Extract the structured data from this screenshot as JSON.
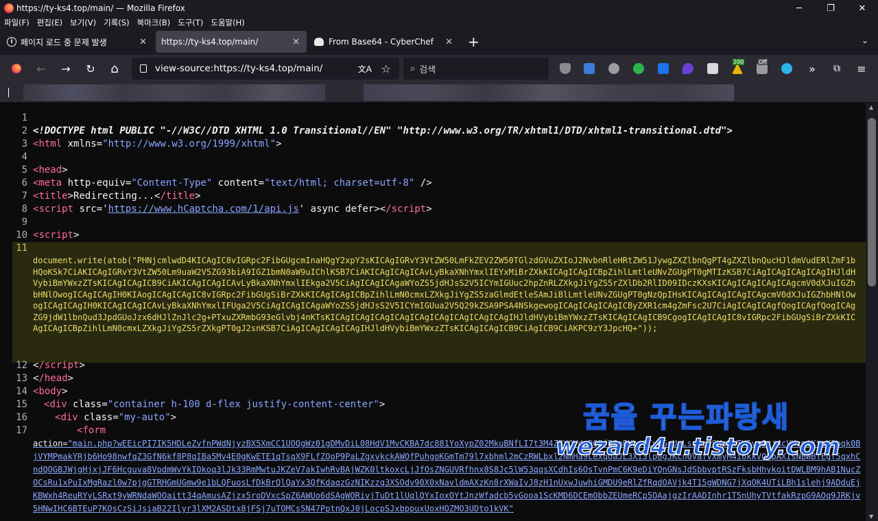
{
  "window": {
    "title": "https://ty-ks4.top/main/ — Mozilla Firefox",
    "minimize": "─",
    "maximize": "❐",
    "close": "✕"
  },
  "menu": [
    "파일(F)",
    "편집(E)",
    "보기(V)",
    "기록(S)",
    "북마크(B)",
    "도구(T)",
    "도움말(H)"
  ],
  "tabs": [
    {
      "label": "페이지 로드 중 문제 발생",
      "close": "✕"
    },
    {
      "label": "https://ty-ks4.top/main/",
      "close": "✕"
    },
    {
      "label": "From Base64 - CyberChef",
      "close": "✕"
    }
  ],
  "tabbar": {
    "new_tab": "+",
    "list_all": "⌄"
  },
  "nav": {
    "url": "view-source:https://ty-ks4.top/main/",
    "search_placeholder": "검색",
    "back": "←",
    "forward": "→",
    "reload": "↻",
    "home": "⌂",
    "badge_count": "200",
    "badge_off": "Off"
  },
  "source": {
    "line_numbers": [
      "1",
      "2",
      "3",
      "4",
      "5",
      "6",
      "7",
      "8",
      "9",
      "10",
      "11",
      "12",
      "13",
      "14",
      "15",
      "16",
      "17"
    ],
    "doctype": "<!DOCTYPE html PUBLIC \"-//W3C//DTD XHTML 1.0 Transitional//EN\" \"http://www.w3.org/TR/xhtml1/DTD/xhtml1-transitional.dtd\">",
    "html_tag": "html",
    "xmlns_attr": "xmlns",
    "xmlns_val": "\"http://www.w3.org/1999/xhtml\"",
    "head_tag": "head",
    "meta_tag": "meta",
    "http_equiv_attr": "http-equiv",
    "http_equiv_val": "\"Content-Type\"",
    "content_attr": "content",
    "content_val": "\"text/html; charset=utf-8\"",
    "meta_close": " />",
    "title_tag": "title",
    "title_text": "Redirecting...",
    "title_close": "/title",
    "script_tag": "script",
    "src_attr": "src",
    "src_q": "'",
    "src_link": "https://www.hCaptcha.com/1/api.js",
    "async_defer": " async defer",
    "script_close": "/script",
    "script_open_10": "script",
    "base64_js": "document.write(atob(\"PHNjcmlwdD4KICAgIC8vIGRpc2FibGUgcmInaHQgY2xpY2sKICAgIGRvY3VtZW50LmFkZEV2ZW50TGlzdGVuZXIoJ2NvbnRleHRtZW51JywgZXZlbnQgPT4gZXZlbnQucHJldmVudERlZmF1bHQoKSk7CiAKICAgIGRvY3VtZW50Lm9uaW2V5ZG93biA9IGZ1bmN0aW9uIChlKSB7CiAKICAgICAgICAvLyBkaXNhYmxlIEYxMiBrZXkKICAgICAgICBpZihlLmtleUNvZGUgPT0gMTIzKSB7CiAgICAgICAgICAgIHJldHVybiBmYWxzZTsKICAgICAgICB9CiAKICAgICAgICAvLyBkaXNhYmxlIEkga2V5CiAgICAgICAgaWYoZS5jdHJsS2V5ICYmIGUuc2hpZnRLZXkgJiYgZS5rZXlDb2RlID09IDczKXsKICAgICAgICAgICAgcmV0dXJuIGZhbHNlOwogICAgICAgIH0KIAogICAgICAgIC8vIGRpc2FibGUgSiBrZXkKICAgICAgICBpZihlLmN0cmxLZXkgJiYgZS5zaGlmdEtleSAmJiBlLmtleUNvZGUgPT0gNzQpIHsKICAgICAgICAgICAgcmV0dXJuIGZhbHNlOwogICAgICAgIH0KICAgICAgICAvLyBkaXNhYmxlIFUga2V5CiAgICAgICAgaWYoZS5jdHJsS2V5ICYmIGUua2V5Q29kZSA9PSA4NSkgewogICAgICAgICAgICByZXR1cm4gZmFsc2U7CiAgICAgICAgfQogICAgfQogICAgZG9jdW1lbnQud3JpdGUoJzx6dHJlZnJlc2g+PTxuZXRmbG93eGlvbj4nKTsKICAgICAgICAgICAgICAgICAgICAgICAgICAgIHJldHVybiBmYWxzZTsKICAgICAgICB9CgogICAgICAgIC8vIGRpc2FibGUgSiBrZXkKICAgICAgICBpZihlLmN0cmxLZXkgJiYgZS5rZXkgPT0gJ2snKSB7CiAgICAgICAgICAgIHJldHVybiBmYWxzZTsKICAgICAgICB9CiAgICB9CiAKPC9zY3JpcHQ+\"));",
    "script_close_12": "/script",
    "head_close": "/head",
    "body_tag": "body",
    "div_tag": "div",
    "class_attr": "class",
    "div1_class": "\"container h-100 d-flex justify-content-center\"",
    "div2_class": "\"my-auto\"",
    "form_tag": "form",
    "action_attr": "action=",
    "action_val": "\"main.php?wEEicPI7IK5HDLeZvfnPWdNjyzBX5XmCC1UOQgWz01gDMvDiL08HdV1MvCKBA7dc881YoXypZ02MkuBNfLI7t3M4ZBYOVdwDQBfB6mPHbs6CvBGqUcLsuAeeSKp9lTH5vqJcj4cVHcmiXtxXQbqk0BjVYMPmakYRjb6Ho98nwfqZ3GfN6kf8P8qIBa5Mv4E0gKwETE1qTsqX9FLfZOoP9PaLZgxvkckAWQfPuhgoKGmTm79l7xbhml2mCzRWLbxl2NmHa9LexqUaJL3Xi3lp8gJKcn0VafvxmyM4i6kkVQ8pAXIsNBWBTEgf5qxhCndQOGBJWjgHjxjJF6Hcguva8VpdmWvYkIOkoq3lJk33RmMwtuJKZeV7akIwhRvBAjWZK0ltkoxcLjJfOsZNGUVRfhnx8S8Jc5lW53qqsXCdhIs6OsTvnPmC6K9eDiYQnGNsJdSbbvptRSzFksbHhykoitDWLBM9hAB1NucZOCsRu1xPuIxMgRazl0w7pjgGTRHGmUGmw9e1bLQFuosLfDkBrQlQaYx3QfKdaqzGzNIKzzq3XSOdv90X0xNavldmAXzKn8rXWaIvJ8zH1nUxwJuwhiGMDU9eRlZfRqdOAVjk4T15gWDNG7jXqOK4UTiLBh1slehj9ADduEjKBWxh4ReuRYyLSRxt9yWRNdaWOOaitt34qAmusAZjzx5roDVxcSpZ6AWUo6dSAgWORivjTuDt1lUqlQYxIoxOYtJnzWfadcb5vGooa1ScKMD6DCEmObbZEUmeRCp5OAajgzIrAADInhr1T5nUhyTVtfakRzpG9AOq9JRKjv5HNwIHC6BTEuP7KOsCzSiJsiaB22Ilyr3lXM2ASDtx8jFSj7uTOMCs5N47PptnQxJ0jLocpSJxbppuxUoxHOZMO3UDto1kVK\""
  }
}
